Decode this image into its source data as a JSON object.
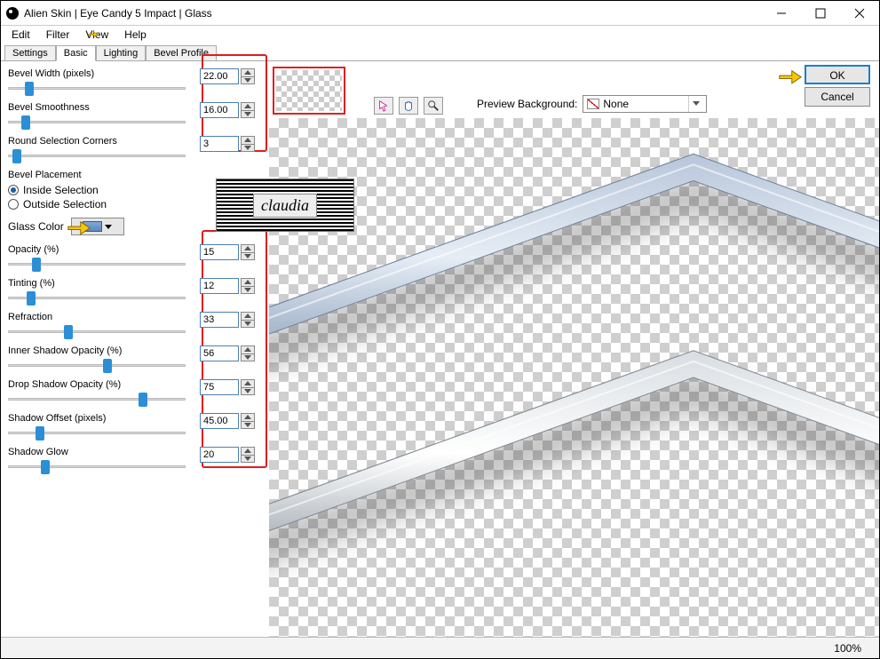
{
  "window": {
    "title": "Alien Skin | Eye Candy 5 Impact | Glass"
  },
  "menu": {
    "items": [
      "Edit",
      "Filter",
      "View",
      "Help"
    ]
  },
  "tabs": {
    "items": [
      "Settings",
      "Basic",
      "Lighting",
      "Bevel Profile"
    ],
    "active": 1
  },
  "params": {
    "bevel_width": {
      "label": "Bevel Width (pixels)",
      "value": "22.00",
      "thumb_pct": 12
    },
    "bevel_smoothness": {
      "label": "Bevel Smoothness",
      "value": "16.00",
      "thumb_pct": 10
    },
    "round_corners": {
      "label": "Round Selection Corners",
      "value": "3",
      "thumb_pct": 5
    },
    "opacity": {
      "label": "Opacity (%)",
      "value": "15",
      "thumb_pct": 16
    },
    "tinting": {
      "label": "Tinting (%)",
      "value": "12",
      "thumb_pct": 13
    },
    "refraction": {
      "label": "Refraction",
      "value": "33",
      "thumb_pct": 34
    },
    "inner_shadow": {
      "label": "Inner Shadow Opacity (%)",
      "value": "56",
      "thumb_pct": 56
    },
    "drop_shadow": {
      "label": "Drop Shadow Opacity (%)",
      "value": "75",
      "thumb_pct": 76
    },
    "shadow_offset": {
      "label": "Shadow Offset (pixels)",
      "value": "45.00",
      "thumb_pct": 18
    },
    "shadow_glow": {
      "label": "Shadow Glow",
      "value": "20",
      "thumb_pct": 21
    }
  },
  "bevel_placement": {
    "label": "Bevel Placement",
    "options": [
      "Inside Selection",
      "Outside Selection"
    ],
    "selected": 0
  },
  "glass_color": {
    "label": "Glass Color"
  },
  "preview_bg": {
    "label": "Preview Background:",
    "value": "None"
  },
  "buttons": {
    "ok": "OK",
    "cancel": "Cancel"
  },
  "watermark": "claudia",
  "status": {
    "zoom": "100%"
  }
}
